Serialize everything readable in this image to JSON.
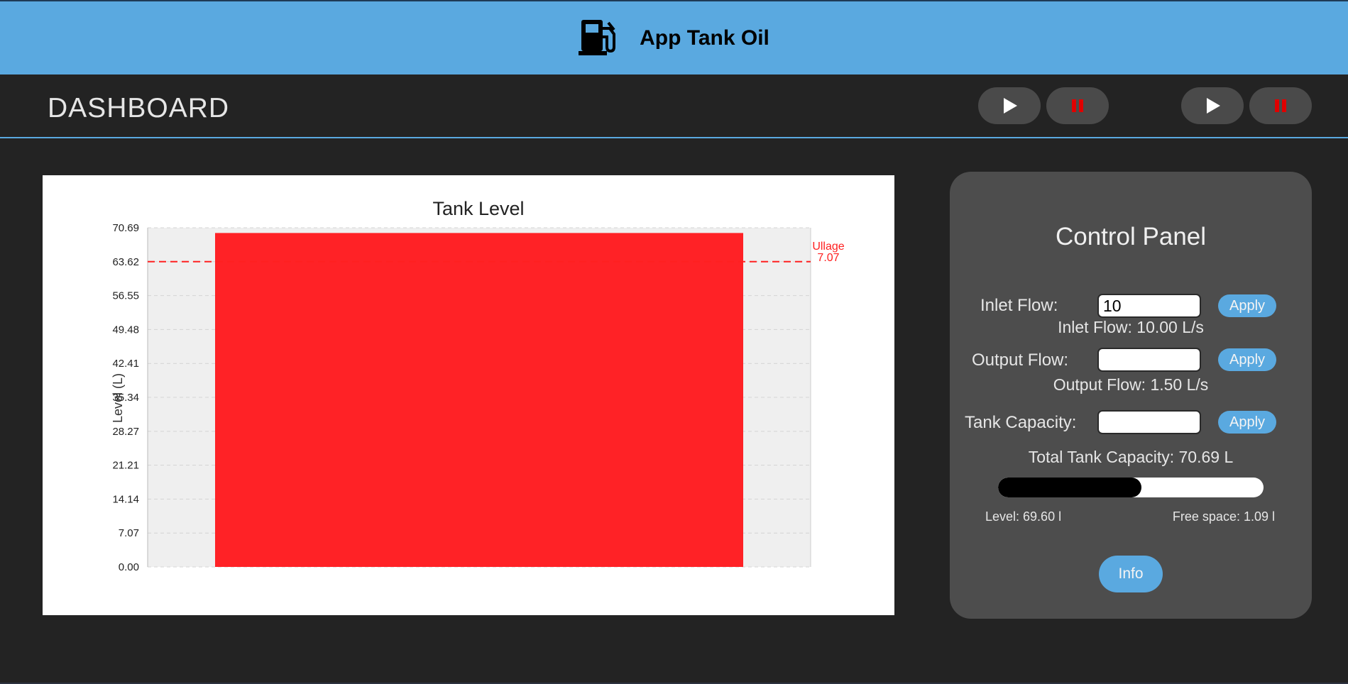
{
  "header": {
    "title": "App Tank Oil",
    "icon": "fuel-pump-icon"
  },
  "navbar": {
    "title": "DASHBOARD",
    "controls": [
      {
        "name": "play-button-1",
        "icon": "play-icon"
      },
      {
        "name": "pause-button-1",
        "icon": "pause-icon"
      },
      {
        "name": "play-button-2",
        "icon": "play-icon"
      },
      {
        "name": "pause-button-2",
        "icon": "pause-icon"
      }
    ]
  },
  "chart_data": {
    "type": "bar",
    "title": "Tank Level",
    "ylabel": "Level (L)",
    "xlabel": "",
    "categories": [
      ""
    ],
    "values": [
      69.6
    ],
    "ylim": [
      0,
      70.69
    ],
    "yticks": [
      "0.00",
      "7.07",
      "14.14",
      "21.21",
      "28.27",
      "35.34",
      "42.41",
      "49.48",
      "56.55",
      "63.62",
      "70.69"
    ],
    "grid": true,
    "threshold": {
      "label": "Ullage",
      "value_label": "7.07",
      "y": 63.62,
      "color": "#ff2020"
    },
    "bar_color": "#ff2226"
  },
  "panel": {
    "title": "Control Panel",
    "inlet": {
      "label": "Inlet Flow:",
      "value": "10",
      "apply": "Apply",
      "status": "Inlet Flow: 10.00 L/s"
    },
    "output": {
      "label": "Output Flow:",
      "value": "",
      "apply": "Apply",
      "status": "Output Flow: 1.50 L/s"
    },
    "capacity": {
      "label": "Tank Capacity:",
      "value": "",
      "apply": "Apply",
      "status": "Total Tank Capacity: 70.69 L"
    },
    "progress": {
      "level_fraction": 0.54
    },
    "level_text": "Level: 69.60 l",
    "free_text": "Free space: 1.09 l",
    "info": "Info"
  },
  "colors": {
    "accent": "#5aa9e0",
    "background": "#232323",
    "panel": "#4d4d4d",
    "danger": "#e00000"
  }
}
